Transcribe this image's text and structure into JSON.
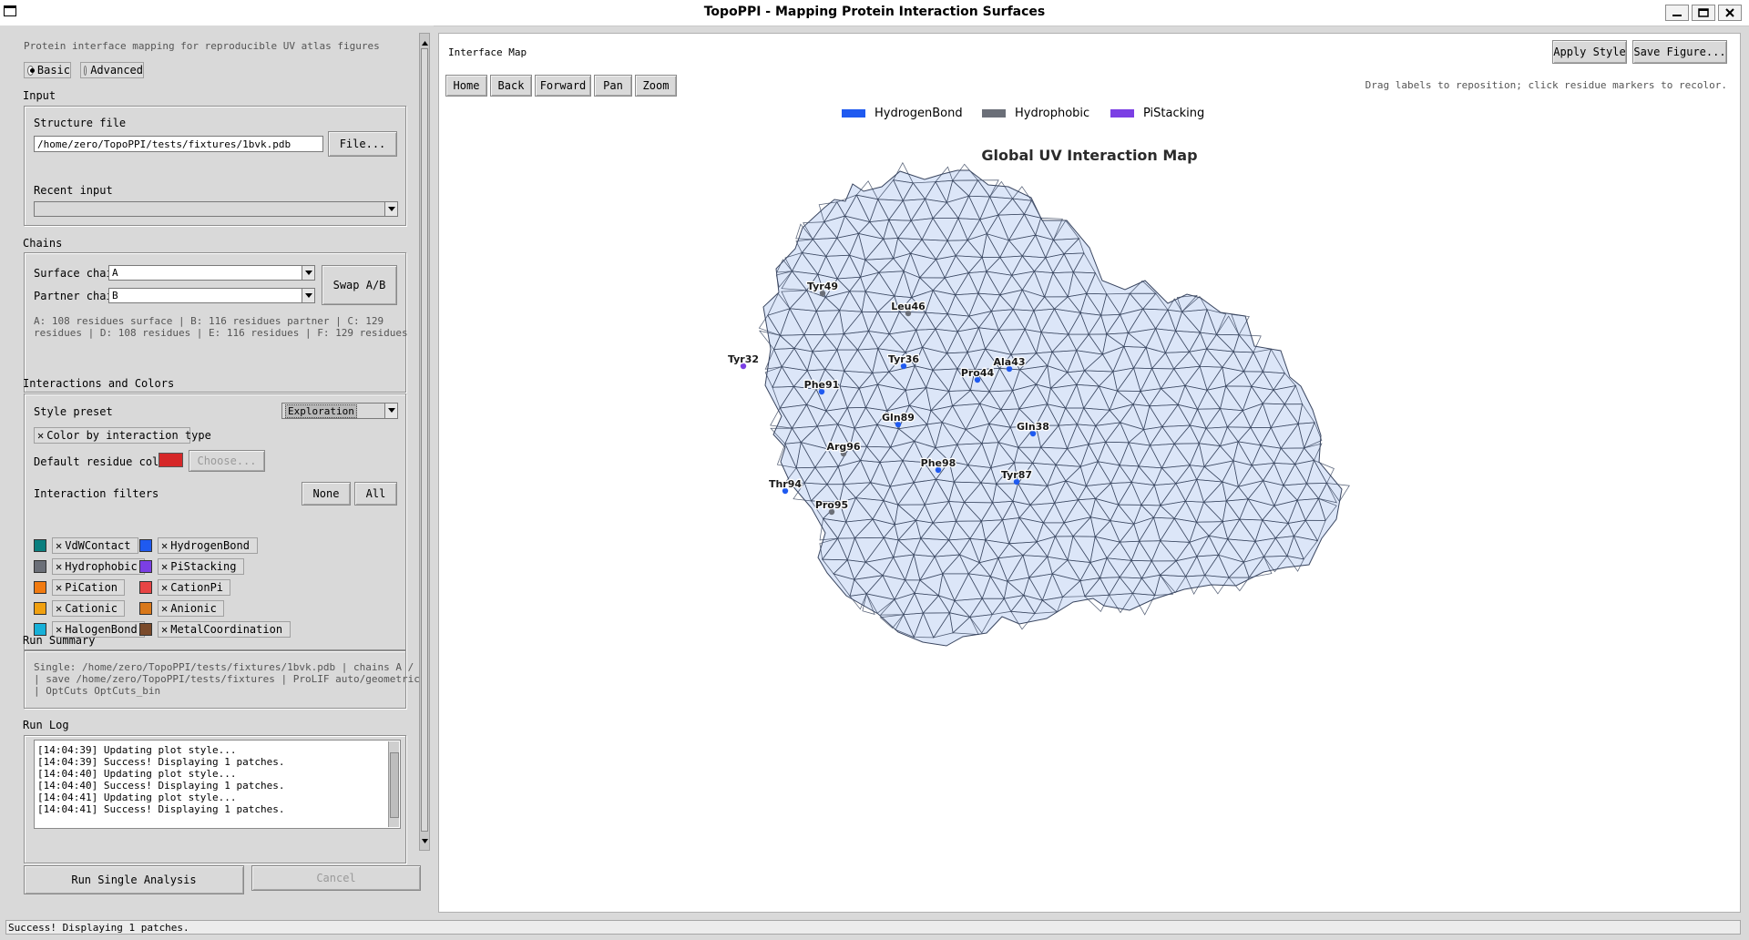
{
  "window": {
    "title": "TopoPPI - Mapping Protein Interaction Surfaces"
  },
  "left": {
    "subtitle": "Protein interface mapping for reproducible UV atlas figures",
    "mode": {
      "basic": "Basic",
      "advanced": "Advanced",
      "selected": "Basic"
    },
    "input": {
      "section": "Input",
      "structure_label": "Structure file",
      "structure_value": "/home/zero/TopoPPI/tests/fixtures/1bvk.pdb",
      "file_button": "File...",
      "recent_label": "Recent input",
      "recent_value": ""
    },
    "chains": {
      "section": "Chains",
      "surface_label": "Surface chain",
      "surface_value": "A",
      "partner_label": "Partner chain",
      "partner_value": "B",
      "swap_button": "Swap A/B",
      "summary_line1": "A: 108 residues surface | B: 116 residues partner | C: 129",
      "summary_line2": "residues | D: 108 residues | E: 116 residues | F: 129 residues"
    },
    "interactions": {
      "section": "Interactions and Colors",
      "style_label": "Style preset",
      "style_value": "Exploration",
      "color_by_type": "Color by interaction type",
      "default_color_label": "Default residue color",
      "default_color": "#d62728",
      "choose_button": "Choose...",
      "filters_label": "Interaction filters",
      "none_button": "None",
      "all_button": "All",
      "filters": [
        {
          "name": "VdWContact",
          "color": "#0a7f7f",
          "checked": true
        },
        {
          "name": "HydrogenBond",
          "color": "#1f5af0",
          "checked": true
        },
        {
          "name": "Hydrophobic",
          "color": "#6b6f78",
          "checked": true
        },
        {
          "name": "PiStacking",
          "color": "#7b3fe4",
          "checked": true
        },
        {
          "name": "PiCation",
          "color": "#f07a10",
          "checked": true
        },
        {
          "name": "CationPi",
          "color": "#e84444",
          "checked": true
        },
        {
          "name": "Cationic",
          "color": "#f0a010",
          "checked": true
        },
        {
          "name": "Anionic",
          "color": "#d9781a",
          "checked": true
        },
        {
          "name": "HalogenBond",
          "color": "#17b0d8",
          "checked": true
        },
        {
          "name": "MetalCoordination",
          "color": "#7a4a2a",
          "checked": true
        }
      ]
    },
    "summary": {
      "section": "Run Summary",
      "line1": "Single: /home/zero/TopoPPI/tests/fixtures/1bvk.pdb | chains A / B",
      "line2": "| save /home/zero/TopoPPI/tests/fixtures | ProLIF auto/geometric",
      "line3": "| OptCuts OptCuts_bin"
    },
    "log": {
      "section": "Run Log",
      "lines": [
        "[14:04:39] Updating plot style...",
        "[14:04:39] Success! Displaying 1 patches.",
        "[14:04:40] Updating plot style...",
        "[14:04:40] Success! Displaying 1 patches.",
        "[14:04:41] Updating plot style...",
        "[14:04:41] Success! Displaying 1 patches."
      ]
    },
    "run_button": "Run Single Analysis",
    "cancel_button": "Cancel"
  },
  "right": {
    "heading": "Interface Map",
    "apply_button": "Apply Style",
    "save_button": "Save Figure...",
    "toolbar": [
      "Home",
      "Back",
      "Forward",
      "Pan",
      "Zoom"
    ],
    "hint": "Drag labels to reposition; click residue markers to recolor.",
    "legend": [
      {
        "name": "HydrogenBond",
        "color": "#1f5af0"
      },
      {
        "name": "Hydrophobic",
        "color": "#6b6f78"
      },
      {
        "name": "PiStacking",
        "color": "#7b3fe4"
      }
    ],
    "map_title": "Global UV Interaction Map",
    "mesh_fill": "#dce6f8",
    "mesh_stroke": "#3a4660",
    "residues": [
      {
        "label": "Tyr49",
        "type": "Hydrophobic"
      },
      {
        "label": "Leu46",
        "type": "Hydrophobic"
      },
      {
        "label": "Tyr32",
        "type": "PiStacking"
      },
      {
        "label": "Tyr36",
        "type": "HydrogenBond"
      },
      {
        "label": "Ala43",
        "type": "HydrogenBond"
      },
      {
        "label": "Pro44",
        "type": "HydrogenBond"
      },
      {
        "label": "Phe91",
        "type": "HydrogenBond"
      },
      {
        "label": "Gln89",
        "type": "HydrogenBond"
      },
      {
        "label": "Gln38",
        "type": "HydrogenBond"
      },
      {
        "label": "Arg96",
        "type": "Hydrophobic"
      },
      {
        "label": "Phe98",
        "type": "HydrogenBond"
      },
      {
        "label": "Tyr87",
        "type": "HydrogenBond"
      },
      {
        "label": "Thr94",
        "type": "HydrogenBond"
      },
      {
        "label": "Pro95",
        "type": "Hydrophobic"
      }
    ]
  },
  "status": "Success! Displaying 1 patches."
}
